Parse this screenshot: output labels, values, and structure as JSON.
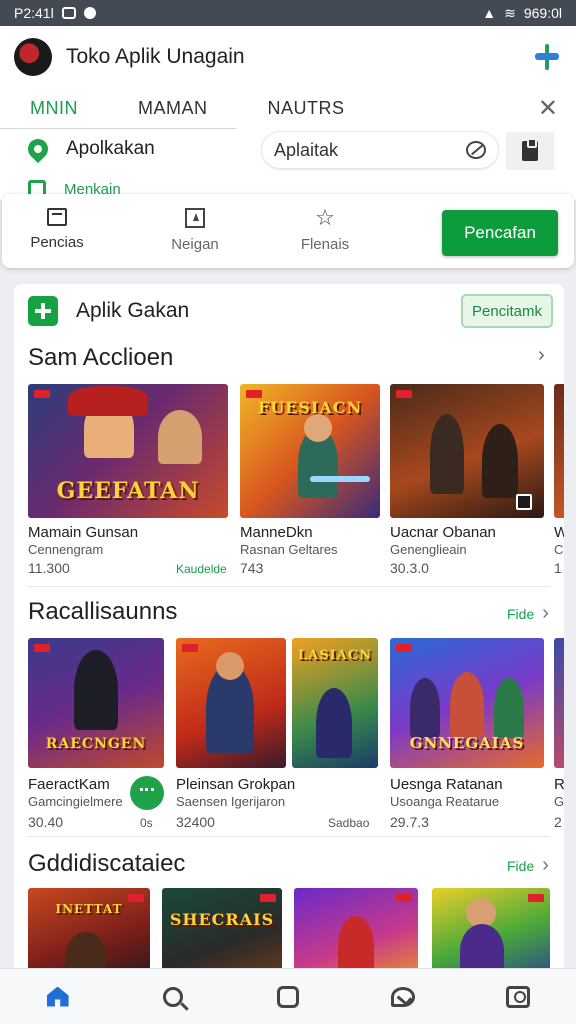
{
  "status_bar": {
    "left_text": "P2:41l",
    "right_text": "969:0l"
  },
  "header": {
    "title": "Toko Aplik Unagain"
  },
  "tabs": [
    {
      "label": "MNIN",
      "active": true
    },
    {
      "label": "MAMAN",
      "active": false
    },
    {
      "label": "NAUTRS",
      "active": false
    }
  ],
  "shortcuts": {
    "primary": "Apolkakan",
    "secondary": "Menkain"
  },
  "search": {
    "value": "Aplaitak"
  },
  "actions": {
    "item1": "Pencias",
    "item2": "Neigan",
    "item3": "Flenais",
    "primary_button": "Pencafan"
  },
  "card": {
    "title": "Aplik Gakan",
    "button": "Pencitamk"
  },
  "sections": [
    {
      "title": "Sam Acclioen",
      "apps": [
        {
          "name": "Mamain Gunsan",
          "dev": "Cennengram",
          "rating": "11.300",
          "extra": "Kaudelde",
          "logo": "GEEFATAN"
        },
        {
          "name": "ManneDkn",
          "dev": "Rasnan Geltares",
          "rating": "743",
          "logo": "FUESIACN"
        },
        {
          "name": "Uacnar Obanan",
          "dev": "Genenglieain",
          "rating": "30.3.0",
          "logo": ""
        },
        {
          "name": "W",
          "dev": "C",
          "rating": "1",
          "logo": ""
        }
      ]
    },
    {
      "title": "Racallisaunns",
      "see_more": "Fide",
      "apps": [
        {
          "name": "FaeractKam",
          "dev": "Gamcingielmere",
          "rating": "30.40",
          "extra": "0s",
          "logo": "RAECNGEN"
        },
        {
          "name": "Pleinsan Grokpan",
          "dev": "Saensen Igerijaron",
          "rating": "32400",
          "extra": "Sadbao",
          "logo": "LASIACN"
        },
        {
          "name": "Uesnga Ratanan",
          "dev": "Usoanga Reatarue",
          "rating": "29.7.3",
          "logo": "GNNEGAIAS"
        },
        {
          "name": "R",
          "dev": "G",
          "rating": "2",
          "logo": ""
        }
      ]
    },
    {
      "title": "Gddidiscataiec",
      "see_more": "Fide",
      "apps": [
        {
          "name": "",
          "logo": "INETTAT"
        },
        {
          "name": "",
          "logo": "SHECRAIS"
        },
        {
          "name": "",
          "logo": ""
        },
        {
          "name": "",
          "logo": ""
        }
      ]
    }
  ],
  "bottom_nav": [
    "home-icon",
    "search-icon",
    "square-icon",
    "chat-icon",
    "profile-icon"
  ],
  "colors": {
    "accent": "#0d9c3c",
    "nav_active": "#1f6fd6"
  }
}
